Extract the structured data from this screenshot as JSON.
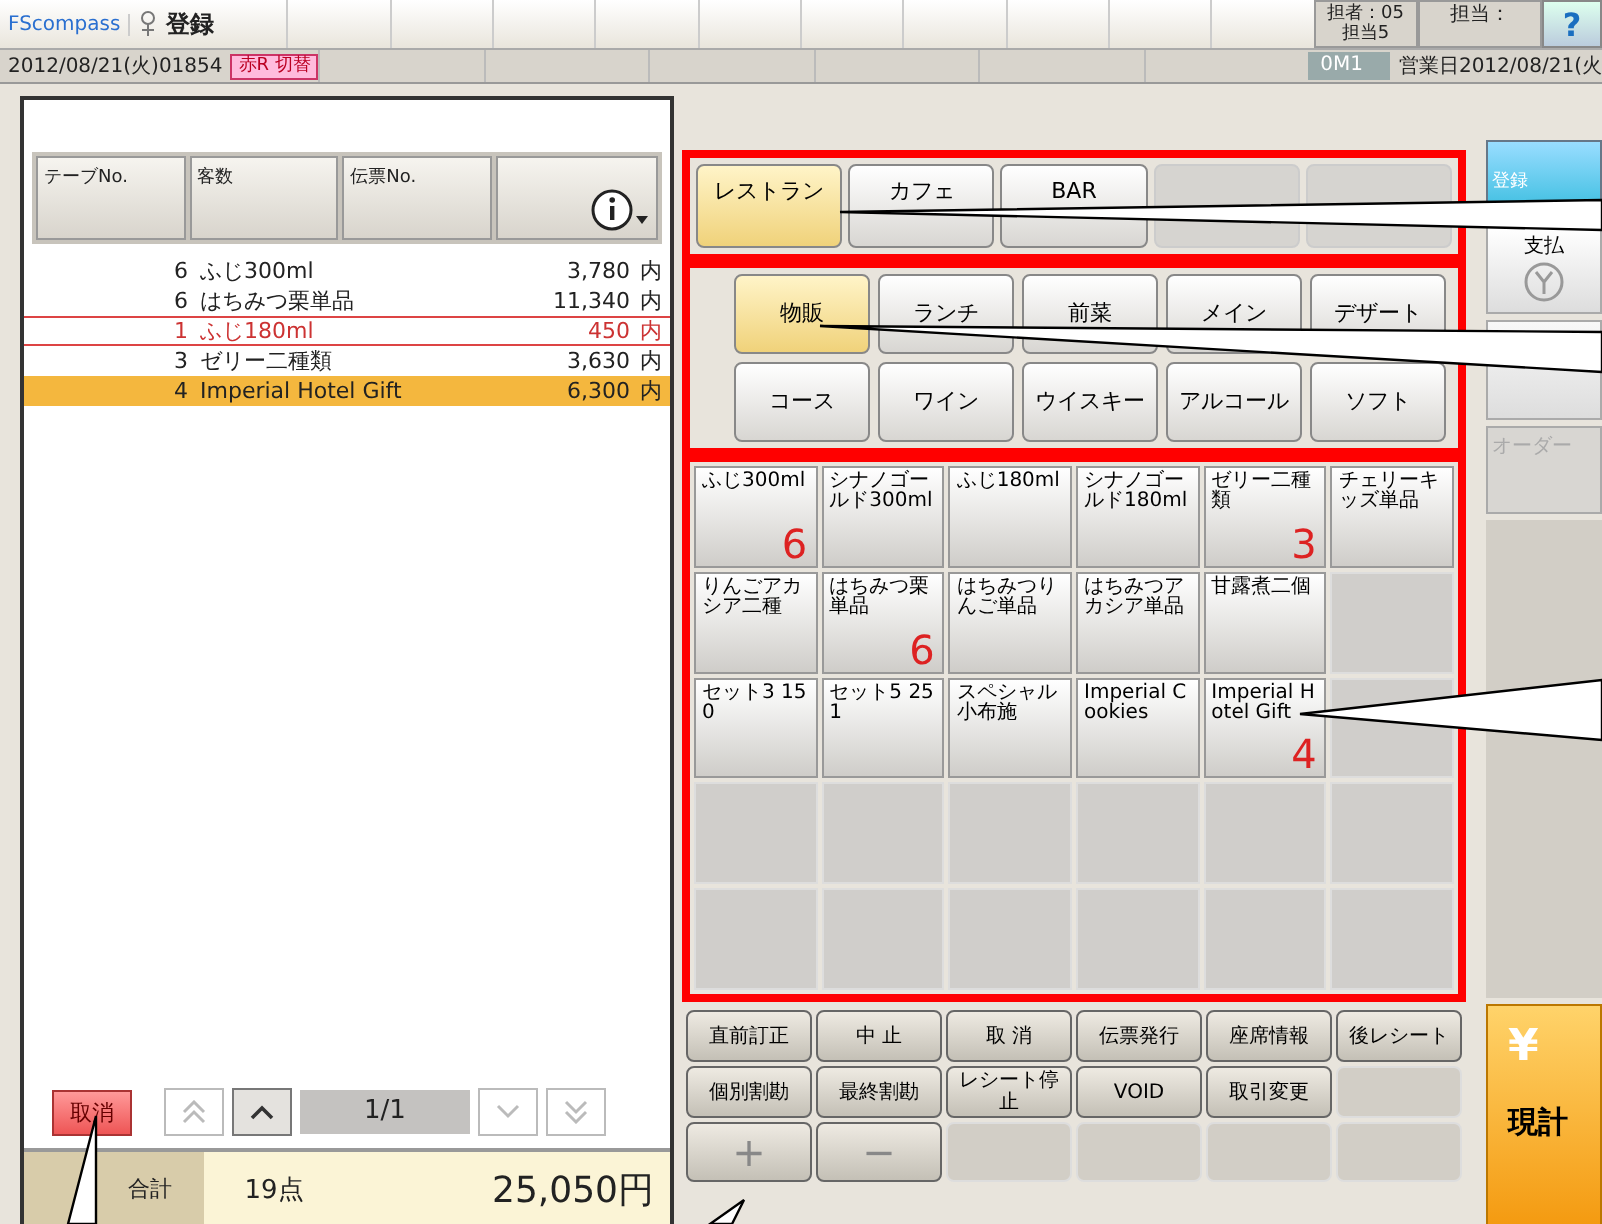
{
  "header": {
    "logo": "FScompass",
    "title": "登録",
    "operator": "担者：05",
    "operator_name": "担当5",
    "staff": "担当：",
    "help": "?"
  },
  "status": {
    "datetime": "2012/08/21(火)01854",
    "receipt_toggle": "赤R 切替",
    "mode": "0M1",
    "business_date": "営業日2012/08/21(火"
  },
  "columns": [
    "テーブNo.",
    "客数",
    "伝票No."
  ],
  "lines": [
    {
      "qty": "6",
      "name": "ふじ300ml",
      "amount": "3,780",
      "tax": "内",
      "voided": false,
      "selected": false
    },
    {
      "qty": "6",
      "name": "はちみつ栗単品",
      "amount": "11,340",
      "tax": "内",
      "voided": false,
      "selected": false
    },
    {
      "qty": "1",
      "name": "ふじ180ml",
      "amount": "450",
      "tax": "内",
      "voided": true,
      "selected": false
    },
    {
      "qty": "3",
      "name": "ゼリー二種類",
      "amount": "3,630",
      "tax": "内",
      "voided": false,
      "selected": false
    },
    {
      "qty": "4",
      "name": "Imperial Hotel Gift",
      "amount": "6,300",
      "tax": "内",
      "voided": false,
      "selected": true
    }
  ],
  "cancel_button": "取消",
  "pager": {
    "page": "1/1"
  },
  "total": {
    "label": "合計",
    "count": "19点",
    "amount": "25,050円"
  },
  "categories": [
    {
      "label": "レストラン",
      "selected": true
    },
    {
      "label": "カフェ",
      "selected": false
    },
    {
      "label": "BAR",
      "selected": false
    }
  ],
  "subcategories": [
    {
      "label": "物販",
      "selected": true
    },
    {
      "label": "ランチ",
      "selected": false
    },
    {
      "label": "前菜",
      "selected": false
    },
    {
      "label": "メイン",
      "selected": false
    },
    {
      "label": "デザート",
      "selected": false
    },
    {
      "label": "コース",
      "selected": false
    },
    {
      "label": "ワイン",
      "selected": false
    },
    {
      "label": "ウイスキー",
      "selected": false
    },
    {
      "label": "アルコール",
      "selected": false
    },
    {
      "label": "ソフト",
      "selected": false
    }
  ],
  "items": [
    [
      {
        "name": "ふじ300ml",
        "count": "6"
      },
      {
        "name": "シナノゴールド300ml"
      },
      {
        "name": "ふじ180ml"
      },
      {
        "name": "シナノゴールド180ml"
      },
      {
        "name": "ゼリー二種類",
        "count": "3"
      },
      {
        "name": "チェリーキッズ単品"
      }
    ],
    [
      {
        "name": "りんごアカシア二種"
      },
      {
        "name": "はちみつ栗単品",
        "count": "6"
      },
      {
        "name": "はちみつりんご単品"
      },
      {
        "name": "はちみつアカシア単品"
      },
      {
        "name": "甘露煮二個"
      }
    ],
    [
      {
        "name": "セット3 150"
      },
      {
        "name": "セット5 251"
      },
      {
        "name": "スペシャル小布施"
      },
      {
        "name": "Imperial Cookies"
      },
      {
        "name": "Imperial Hotel Gift",
        "count": "4"
      }
    ]
  ],
  "functions": [
    [
      "直前訂正",
      "中 止",
      "取 消",
      "伝票発行",
      "座席情報",
      "後レシート"
    ],
    [
      "個別割勘",
      "最終割勘",
      "レシート停止",
      "VOID",
      "取引変更"
    ],
    [
      "+",
      "−"
    ]
  ],
  "side": {
    "register": "登録",
    "payment": "支払",
    "order": "オーダー",
    "yen": "¥",
    "checkout": "現計"
  }
}
